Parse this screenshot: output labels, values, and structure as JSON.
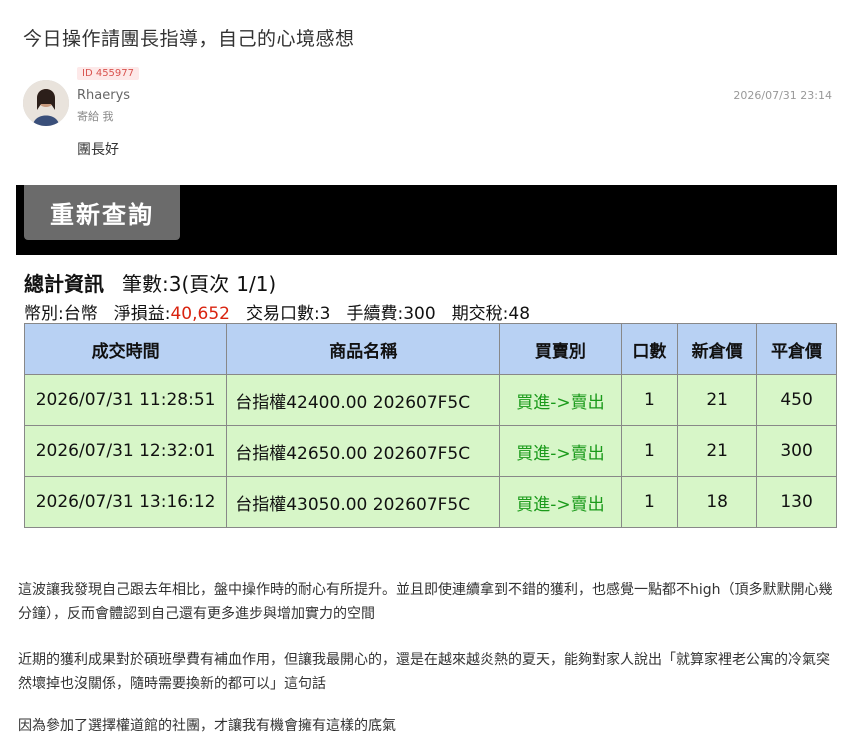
{
  "message": {
    "title": "今日操作請團長指導，自己的心境感想",
    "id_badge": "ID 455977",
    "sender": "Rhaerys",
    "to_line": "寄給 我",
    "timestamp": "2026/07/31 23:14",
    "greeting": "團長好"
  },
  "screenshot": {
    "requery_label": "重新查詢",
    "summary_label": "總計資訊",
    "count_label": "筆數:3(頁次",
    "page": "1/1)",
    "currency": "幣別:台幣",
    "net_pl_label": "淨損益:",
    "net_pl_value": "40,652",
    "lots": "交易口數:3",
    "fee": "手續費:300",
    "tax": "期交稅:48",
    "columns": [
      "成交時間",
      "商品名稱",
      "買賣別",
      "口數",
      "新倉價",
      "平倉價"
    ],
    "rows": [
      [
        "2026/07/31 11:28:51",
        "台指權42400.00 202607F5C",
        "買進->賣出",
        "1",
        "21",
        "450"
      ],
      [
        "2026/07/31 12:32:01",
        "台指權42650.00 202607F5C",
        "買進->賣出",
        "1",
        "21",
        "300"
      ],
      [
        "2026/07/31 13:16:12",
        "台指權43050.00 202607F5C",
        "買進->賣出",
        "1",
        "18",
        "130"
      ]
    ]
  },
  "body": {
    "p1": "這波讓我發現自己跟去年相比，盤中操作時的耐心有所提升。並且即使連續拿到不錯的獲利，也感覺一點都不high（頂多默默開心幾分鐘），反而會體認到自己還有更多進步與增加實力的空間",
    "p2": "近期的獲利成果對於碩班學費有補血作用，但讓我最開心的，還是在越來越炎熱的夏天，能夠對家人說出「就算家裡老公寓的冷氣突然壞掉也沒關係，隨時需要換新的都可以」這句話",
    "p3": "因為參加了選擇權道館的社團，才讓我有機會擁有這樣的底氣"
  },
  "colors": {
    "header_bg": "#b8d1f3",
    "row_bg": "#d7f6c8",
    "profit_red": "#d9230f",
    "action_green": "#1a9a1a"
  }
}
